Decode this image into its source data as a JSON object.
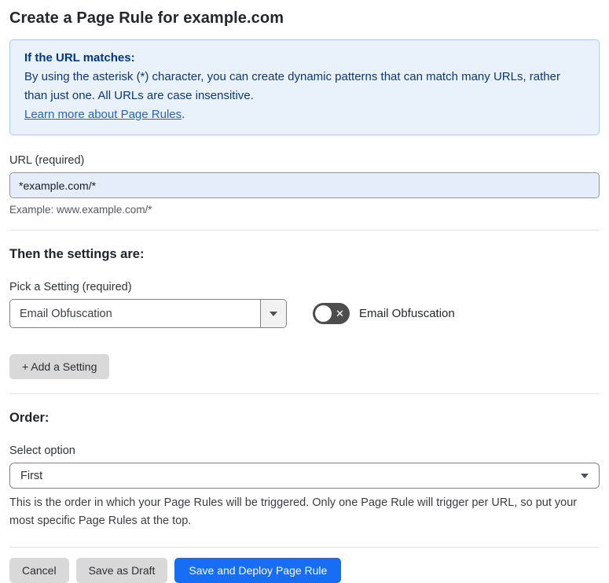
{
  "page_title": "Create a Page Rule for example.com",
  "info_box": {
    "heading": "If the URL matches:",
    "body": "By using the asterisk (*) character, you can create dynamic patterns that can match many URLs, rather than just one. All URLs are case insensitive.",
    "link_label": "Learn more about Page Rules",
    "link_suffix": "."
  },
  "url_field": {
    "label": "URL (required)",
    "value": "*example.com/*",
    "helper": "Example: www.example.com/*"
  },
  "settings_section": {
    "heading": "Then the settings are:",
    "picker_label": "Pick a Setting (required)",
    "picker_value": "Email Obfuscation",
    "toggle_label": "Email Obfuscation",
    "toggle_state": "off",
    "toggle_x_glyph": "✕",
    "add_setting_label": "+ Add a Setting"
  },
  "order_section": {
    "heading": "Order:",
    "select_label": "Select option",
    "select_value": "First",
    "helper": "This is the order in which your Page Rules will be triggered. Only one Page Rule will trigger per URL, so put your most specific Page Rules at the top."
  },
  "footer": {
    "cancel_label": "Cancel",
    "save_draft_label": "Save as Draft",
    "save_deploy_label": "Save and Deploy Page Rule"
  },
  "colors": {
    "accent_blue": "#186df5",
    "info_bg": "#e9f2fb",
    "info_border": "#aecde8",
    "info_text": "#003682",
    "link_blue": "#2563c4",
    "input_bg": "#e5ecfa",
    "toggle_off_bg": "#4d4d4d",
    "button_gray": "#d9d9d9"
  }
}
